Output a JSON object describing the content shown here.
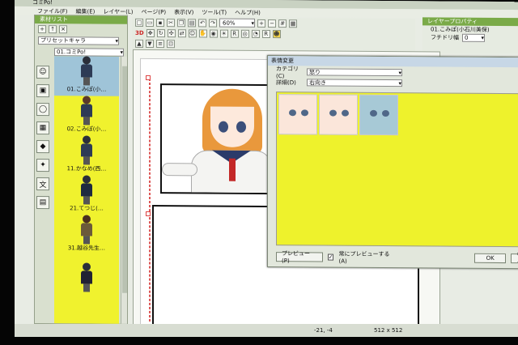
{
  "app": {
    "title": "コミPo!"
  },
  "menu": [
    "ファイル(F)",
    "編集(E)",
    "レイヤー(L)",
    "ページ(P)",
    "表示(V)",
    "ツール(T)",
    "ヘルプ(H)"
  ],
  "toolbar": {
    "zoom": "60%",
    "mode_3d": "3D"
  },
  "material_panel": {
    "title": "素材リスト",
    "preset": "プリセットキャラ",
    "subselect": "01.コミPo!",
    "items": [
      "01.こみぽ(小…",
      "02.こみぽ(小…",
      "11.かなめ(西…",
      "21.てつじ(…",
      "31.越谷先生…",
      ""
    ]
  },
  "layer_panel": {
    "title": "レイヤープロパティ",
    "layer_name": "01.こみぽ(小石川美保)",
    "outline_label": "フチドリ幅",
    "outline_value": "0"
  },
  "dialog": {
    "title": "表情変更",
    "category_label": "カテゴリ(C)",
    "category_value": "怒り",
    "detail_label": "詳細(D)",
    "detail_value": "右向き",
    "preview_button": "プレビュー(P)",
    "always_preview": "常にプレビューする(A)",
    "ok": "OK",
    "cancel": "キャ"
  },
  "status": {
    "coords": "-21, -4",
    "size": "512 x 512"
  }
}
